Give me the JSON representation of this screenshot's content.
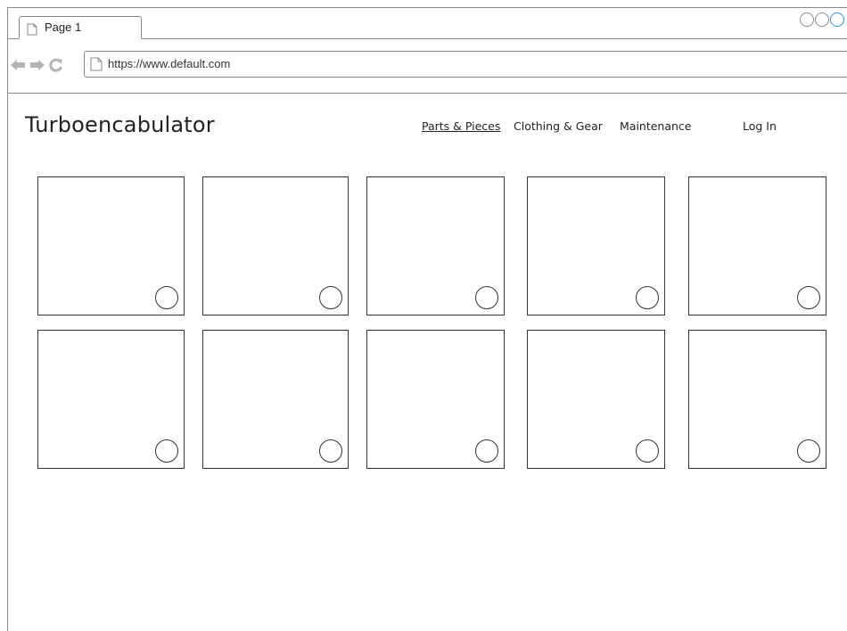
{
  "browser": {
    "tab_title": "Page 1",
    "url": "https://www.default.com",
    "icons": {
      "back": "back-arrow-icon",
      "forward": "forward-arrow-icon",
      "reload": "reload-icon",
      "page": "page-icon"
    },
    "window_controls": [
      "circle-control",
      "circle-control",
      "circle-control"
    ]
  },
  "site": {
    "title": "Turboencabulator",
    "nav": {
      "parts": "Parts & Pieces",
      "clothing": "Clothing & Gear",
      "maintenance": "Maintenance",
      "login": "Log In"
    },
    "active_nav": "Parts & Pieces"
  },
  "grid": {
    "rows": 2,
    "columns": 5,
    "card_count": 10
  },
  "colors": {
    "border": "#333333",
    "chrome_border": "#8a8a8a",
    "accent_control": "#2f8fd8"
  }
}
